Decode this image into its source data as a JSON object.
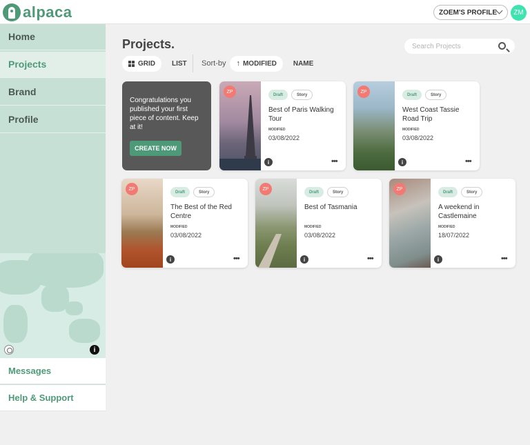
{
  "brand": {
    "name": "alpaca",
    "color": "#4e9a78"
  },
  "header": {
    "profile_label": "ZOEM'S PROFILE",
    "avatar_initials": "ZM"
  },
  "sidebar": {
    "items": [
      {
        "label": "Home",
        "active": false
      },
      {
        "label": "Projects",
        "active": true
      },
      {
        "label": "Brand",
        "active": false
      },
      {
        "label": "Profile",
        "active": false
      }
    ],
    "map_info": "i",
    "bottom_items": [
      {
        "label": "Messages"
      },
      {
        "label": "Help & Support"
      }
    ]
  },
  "main": {
    "title": "Projects.",
    "search_placeholder": "Search Projects",
    "view_options": [
      "GRID",
      "LIST"
    ],
    "sort_label": "Sort-by",
    "sort_options": [
      "MODIFIED",
      "NAME"
    ],
    "promo": {
      "text": "Congratulations you published your first piece of content. Keep at it!",
      "button": "CREATE NOW"
    },
    "cards": [
      {
        "owner": "ZP",
        "status": "Draft",
        "type": "Story",
        "title": "Best of Paris Walking Tour",
        "modified_label": "MODIFIED",
        "date": "03/08/2022",
        "info": "i",
        "more": "•••"
      },
      {
        "owner": "ZP",
        "status": "Draft",
        "type": "Story",
        "title": "West Coast Tassie Road Trip",
        "modified_label": "MODIFIED",
        "date": "03/08/2022",
        "info": "i",
        "more": "•••"
      },
      {
        "owner": "ZP",
        "status": "Draft",
        "type": "Story",
        "title": "The Best of the Red Centre",
        "modified_label": "MODIFIED",
        "date": "03/08/2022",
        "info": "i",
        "more": "•••"
      },
      {
        "owner": "ZP",
        "status": "Draft",
        "type": "Story",
        "title": "Best of Tasmania",
        "modified_label": "MODIFIED",
        "date": "03/08/2022",
        "info": "i",
        "more": "•••"
      },
      {
        "owner": "ZP",
        "status": "Draft",
        "type": "Story",
        "title": "A weekend in Castlemaine",
        "modified_label": "MODIFIED",
        "date": "18/07/2022",
        "info": "i",
        "more": "•••"
      }
    ]
  }
}
